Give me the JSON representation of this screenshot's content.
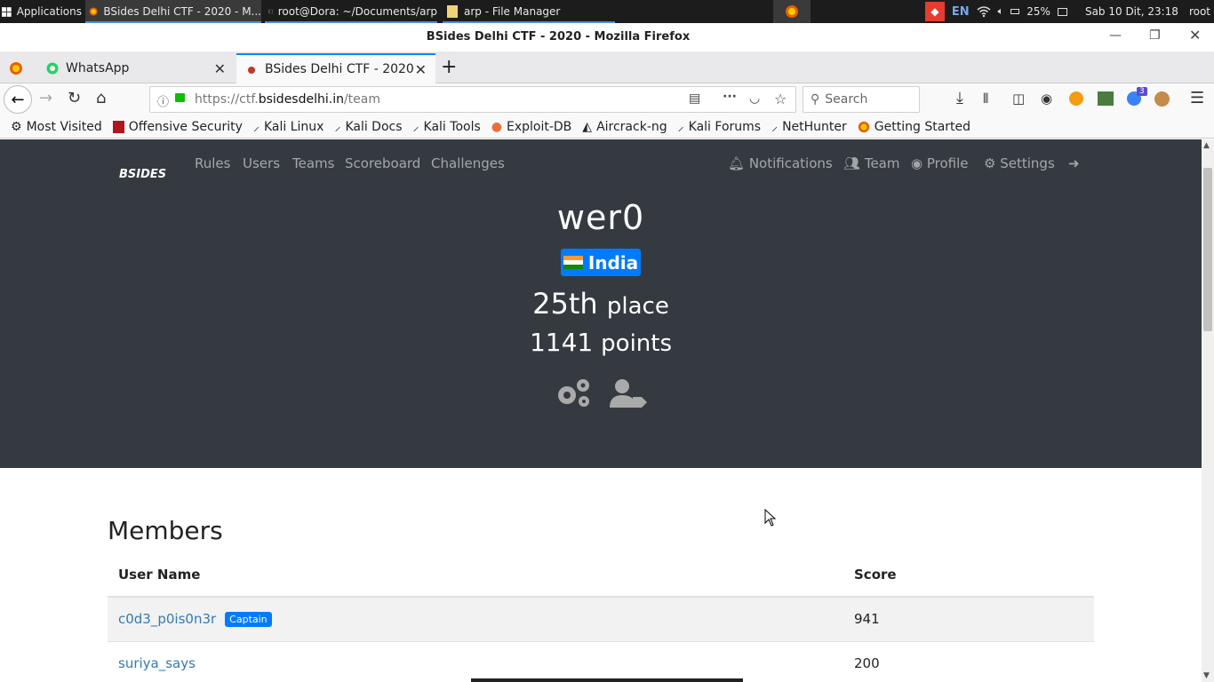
{
  "taskbar": {
    "apps_label": "Applications",
    "windows": [
      {
        "label": "BSides Delhi CTF - 2020 - M...",
        "icon": "firefox-icon"
      },
      {
        "label": "root@Dora: ~/Documents/arp",
        "icon": "terminal-icon"
      },
      {
        "label": "arp - File Manager",
        "icon": "folder-icon"
      }
    ],
    "keyboard_layout": "EN",
    "battery": "25%",
    "datetime": "Sab 10 Dit, 23:18",
    "user": "root"
  },
  "window": {
    "title": "BSides Delhi CTF - 2020 - Mozilla Firefox"
  },
  "tabs": [
    {
      "label": "WhatsApp",
      "icon": "whatsapp-icon"
    },
    {
      "label": "BSides Delhi CTF - 2020",
      "icon": "bsides-favicon"
    }
  ],
  "navbar": {
    "url_prefix": "https://ctf.",
    "url_domain": "bsidesdelhi.in",
    "url_path": "/team",
    "search_placeholder": "Search",
    "extension_badge": "3"
  },
  "bookmarks": [
    {
      "label": "Most Visited",
      "icon": "gear-icon"
    },
    {
      "label": "Offensive Security",
      "icon": "offsec-icon"
    },
    {
      "label": "Kali Linux",
      "icon": "kali-icon"
    },
    {
      "label": "Kali Docs",
      "icon": "kali-icon"
    },
    {
      "label": "Kali Tools",
      "icon": "kali-icon"
    },
    {
      "label": "Exploit-DB",
      "icon": "exploitdb-icon"
    },
    {
      "label": "Aircrack-ng",
      "icon": "aircrack-icon"
    },
    {
      "label": "Kali Forums",
      "icon": "kali-icon"
    },
    {
      "label": "NetHunter",
      "icon": "kali-icon"
    },
    {
      "label": "Getting Started",
      "icon": "firefox-icon"
    }
  ],
  "ctf": {
    "logo_text": "BSIDES",
    "nav_left": [
      "Rules",
      "Users",
      "Teams",
      "Scoreboard",
      "Challenges"
    ],
    "nav_right": [
      "Notifications",
      "Team",
      "Profile",
      "Settings"
    ],
    "team_name": "wer0",
    "country": "India",
    "place_number": "25th",
    "place_word": "place",
    "points_number": "1141",
    "points_word": "points",
    "members_title": "Members",
    "table": {
      "headers": [
        "User Name",
        "Score"
      ],
      "rows": [
        {
          "name": "c0d3_p0is0n3r",
          "badge": "Captain",
          "score": "941"
        },
        {
          "name": "suriya_says",
          "badge": "",
          "score": "200"
        }
      ]
    }
  },
  "colors": {
    "hero_bg": "#343a40",
    "accent_blue": "#007bff",
    "link": "#337ab7"
  }
}
